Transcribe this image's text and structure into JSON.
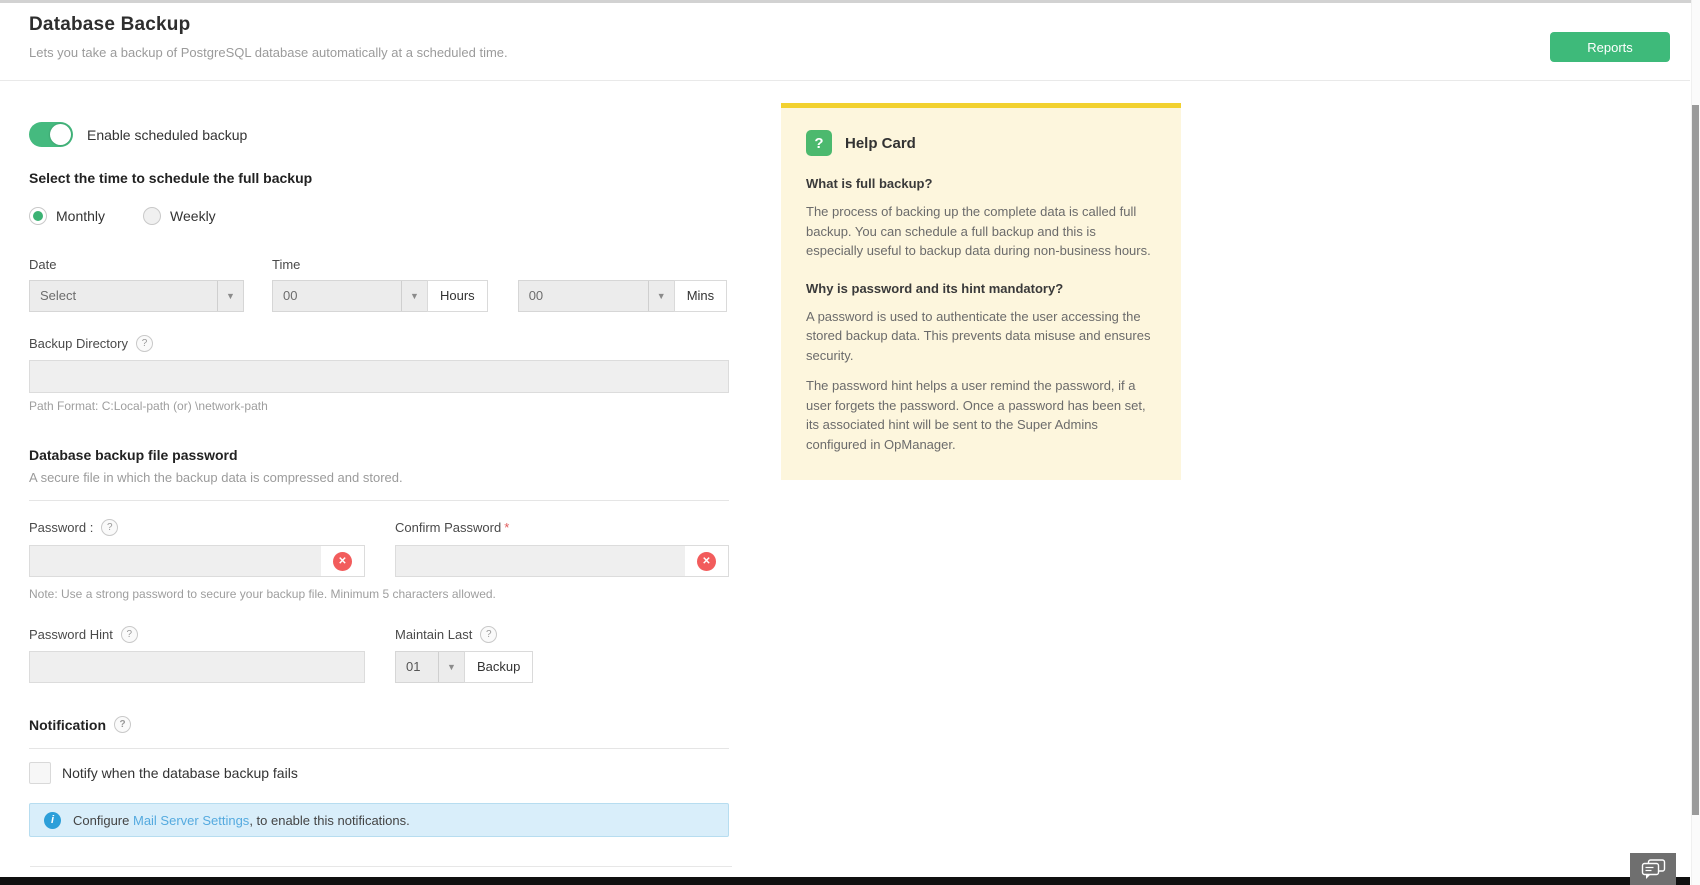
{
  "page": {
    "title": "Database Backup",
    "subtitle": "Lets you take a backup of PostgreSQL database automatically at a scheduled time.",
    "reports_button": "Reports"
  },
  "form": {
    "enable_toggle_label": "Enable scheduled backup",
    "schedule_heading": "Select the time to schedule the full backup",
    "frequency_options": [
      {
        "label": "Monthly",
        "selected": true
      },
      {
        "label": "Weekly",
        "selected": false
      }
    ],
    "date": {
      "label": "Date",
      "value": "Select"
    },
    "time": {
      "label": "Time",
      "hours_value": "00",
      "hours_unit": "Hours",
      "mins_value": "00",
      "mins_unit": "Mins"
    },
    "backup_directory": {
      "label": "Backup Directory",
      "value": "",
      "hint": "Path Format: C:Local-path (or) \\network-path"
    },
    "password_section": {
      "heading": "Database backup file password",
      "description": "A secure file in which the backup data is compressed and stored.",
      "password_label": "Password :",
      "confirm_label": "Confirm Password",
      "required_mark": "*",
      "note": "Note: Use a strong password to secure your backup file. Minimum 5 characters allowed.",
      "hint_label": "Password Hint",
      "maintain_label": "Maintain Last",
      "maintain_value": "01",
      "maintain_unit": "Backup"
    },
    "notification": {
      "heading": "Notification",
      "checkbox_label": "Notify when the database backup fails",
      "info_prefix": "Configure ",
      "info_link": "Mail Server Settings",
      "info_suffix": ", to enable this notifications."
    }
  },
  "help_card": {
    "icon": "?",
    "title": "Help Card",
    "sections": [
      {
        "question": "What is full backup?",
        "answer1": "The process of backing up the complete data is called full backup. You can schedule a full backup and this is especially useful to backup data during non-business hours."
      },
      {
        "question": "Why is password and its hint mandatory?",
        "answer1": "A password is used to authenticate the user accessing the stored backup data. This prevents data misuse and ensures security.",
        "answer2": "The password hint helps a user remind the password, if a user forgets the password. Once a password has been set, its associated hint will be sent to the Super Admins configured in OpManager."
      }
    ]
  },
  "icons": {
    "help": "?",
    "error": "✕",
    "info": "i",
    "dropdown": "▼"
  },
  "colors": {
    "accent_green": "#3eba7a",
    "toggle_green": "#45ba7f",
    "help_card_bg": "#fdf6dd",
    "help_card_border": "#f2d12f",
    "info_bar_bg": "#d9eefa",
    "link_blue": "#55aadf",
    "error_red": "#f25c5c"
  }
}
